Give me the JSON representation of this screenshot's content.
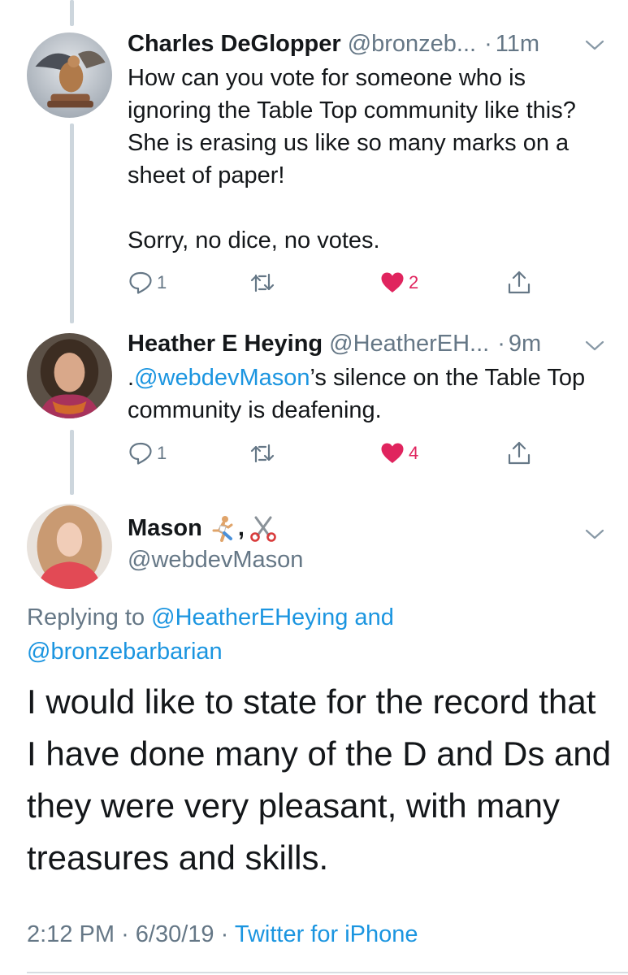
{
  "colors": {
    "link": "#1b95e0",
    "muted": "#657786",
    "like": "#e0245e",
    "thread_line": "#cdd6dd"
  },
  "tweet1": {
    "name": "Charles DeGlopper",
    "handle": "@bronzeb...",
    "time": "11m",
    "text": "How can you vote for someone who is ignoring the Table Top community like this? She is erasing us like so many marks on a sheet of paper!\n\nSorry, no dice, no votes.",
    "reply_count": "1",
    "retweet_count": "",
    "like_count": "2",
    "liked": true,
    "icons": [
      "reply-icon",
      "retweet-icon",
      "heart-icon",
      "share-icon",
      "chevron-down-icon"
    ]
  },
  "tweet2": {
    "name": "Heather E Heying",
    "handle": "@HeatherEH...",
    "time": "9m",
    "text_prefix": ".",
    "text_mention": "@webdevMason",
    "text_rest": "’s silence on the Table Top community is deafening.",
    "reply_count": "1",
    "retweet_count": "",
    "like_count": "4",
    "liked": true
  },
  "main_tweet": {
    "name": "Mason",
    "name_emoji": [
      "running-person-emoji",
      "scissors-emoji"
    ],
    "name_separator": ",",
    "handle": "@webdevMason",
    "replying_to_label": "Replying to",
    "reply_mention_1": "@HeatherEHeying and",
    "reply_mention_2": "@bronzebarbarian",
    "text": "I would like to state for the record that I have done many of the D and Ds and they were very pleasant, with many treasures and skills.",
    "time": "2:12 PM",
    "date": "6/30/19",
    "source": "Twitter for iPhone",
    "meta_separator": "·"
  }
}
